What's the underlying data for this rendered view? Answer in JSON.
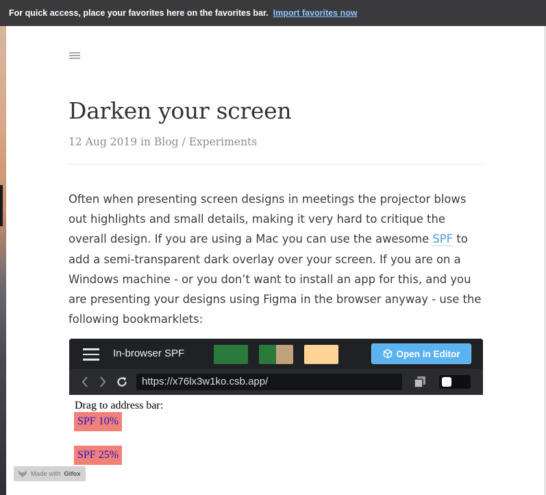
{
  "favorites_bar": {
    "message": "For quick access, place your favorites here on the favorites bar.",
    "import_link": "Import favorites now"
  },
  "post": {
    "title": "Darken your screen",
    "meta": "12 Aug 2019 in Blog / Experiments",
    "paragraph_before_link": "Often when presenting screen designs in meetings the projector blows out highlights and small details, making it very hard to critique the overall design. If you are using a Mac you can use the awesome ",
    "link_text": "SPF",
    "paragraph_after_link": " to add a semi-transparent dark overlay over your screen. If you are on a Windows machine - or you don’t want to install an app for this, and you are presenting your designs using Figma in the browser anyway - use the following bookmarklets:"
  },
  "embed": {
    "title": "In-browser SPF",
    "open_button": "Open in Editor",
    "url": "https://x76lx3w1ko.csb.app/",
    "swatch_colors": [
      "#2a7a3c",
      "#2a7a3c",
      "#c1a27c",
      "#ffd497"
    ]
  },
  "sandbox_content": {
    "drag_label": "Drag to address bar:",
    "bookmarklets": [
      "SPF 10%",
      "SPF 25%"
    ]
  },
  "watermark": {
    "prefix": "Made with",
    "brand": "Gifox"
  }
}
